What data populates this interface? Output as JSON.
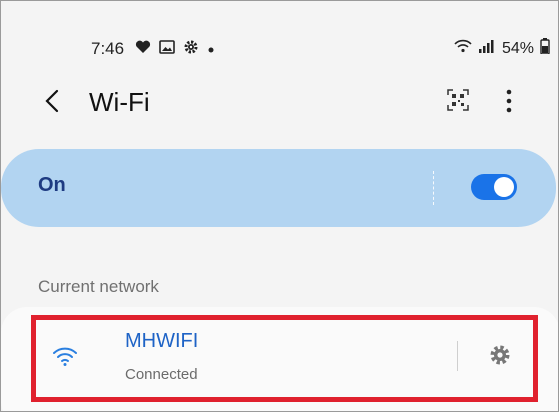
{
  "status_bar": {
    "time": "7:46",
    "left_icons": [
      "heart-icon",
      "image-icon",
      "gear-icon",
      "dot-icon"
    ],
    "right_icons": [
      "wifi-signal-icon",
      "cellular-signal-icon",
      "battery-icon"
    ],
    "battery_text": "54%"
  },
  "header": {
    "back_icon": "chevron-left-icon",
    "title": "Wi-Fi",
    "right_icons": [
      "qr-scan-icon",
      "more-vertical-icon"
    ]
  },
  "wifi_toggle": {
    "label": "On",
    "enabled": true,
    "card_color": "#b2d4f1",
    "switch_color": "#1a73e8"
  },
  "current_network": {
    "section_label": "Current network",
    "name": "MHWIFI",
    "status": "Connected",
    "icon": "wifi-icon",
    "settings_icon": "gear-icon",
    "highlight_color": "#e0212e"
  }
}
